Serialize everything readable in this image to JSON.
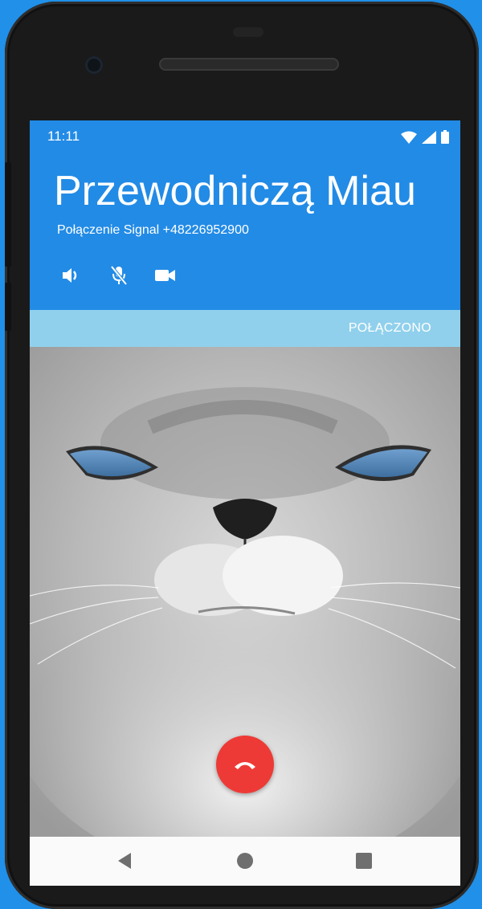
{
  "status_bar": {
    "time": "11:11"
  },
  "call": {
    "name": "Przewodniczą Miau",
    "subtitle": "Połączenie Signal +48226952900",
    "status": "POŁĄCZONO"
  },
  "controls": {
    "speaker": "speaker-icon",
    "mute": "mic-off-icon",
    "video": "videocam-icon",
    "hangup": "call-end-icon"
  },
  "nav": {
    "back": "back-icon",
    "home": "home-icon",
    "recents": "recents-icon"
  },
  "colors": {
    "header": "#228be6",
    "status_bar_strip": "#90d0ec",
    "hangup": "#ee3a36",
    "background": "#2090e8"
  }
}
